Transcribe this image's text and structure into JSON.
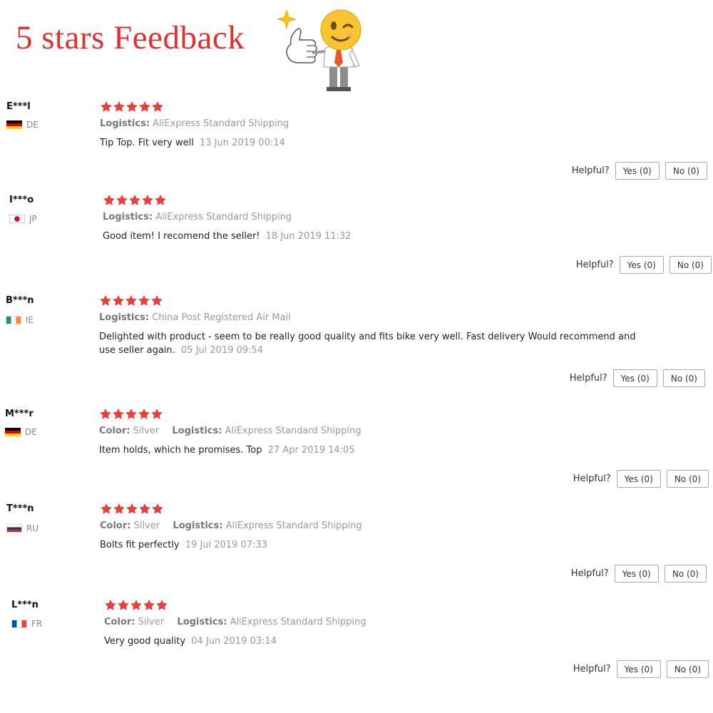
{
  "header": {
    "title": "5 stars Feedback"
  },
  "helpful_label": "Helpful?",
  "star_color": "#e8413c",
  "reviews": [
    {
      "user": "E***l",
      "country": "DE",
      "flag": "germany-flag-icon",
      "rating": 5,
      "color_label": "",
      "color_value": "",
      "logistics_label": "Logistics:",
      "logistics_value": "AliExpress Standard Shipping",
      "text": "Tip Top. Fit very well",
      "date": "13 Jun 2019 00:14",
      "yes": "Yes (0)",
      "no": "No (0)"
    },
    {
      "user": "I***o",
      "country": "JP",
      "flag": "japan-flag-icon",
      "rating": 5,
      "color_label": "",
      "color_value": "",
      "logistics_label": "Logistics:",
      "logistics_value": "AliExpress Standard Shipping",
      "text": "Good item! I recomend the seller!",
      "date": "18 Jun 2019 11:32",
      "yes": "Yes (0)",
      "no": "No (0)"
    },
    {
      "user": "B***n",
      "country": "IE",
      "flag": "ireland-flag-icon",
      "rating": 5,
      "color_label": "",
      "color_value": "",
      "logistics_label": "Logistics:",
      "logistics_value": "China Post Registered Air Mail",
      "text": "Delighted with product - seem to be really good quality and fits bike very well. Fast delivery Would recommend and use seller again.",
      "date": "05 Jul 2019 09:54",
      "yes": "Yes (0)",
      "no": "No (0)"
    },
    {
      "user": "M***r",
      "country": "DE",
      "flag": "germany-flag-icon",
      "rating": 5,
      "color_label": "Color:",
      "color_value": "Silver",
      "logistics_label": "Logistics:",
      "logistics_value": "AliExpress Standard Shipping",
      "text": "Item holds, which he promises. Top",
      "date": "27 Apr 2019 14:05",
      "yes": "Yes (0)",
      "no": "No (0)"
    },
    {
      "user": "T***n",
      "country": "RU",
      "flag": "russia-flag-icon",
      "rating": 5,
      "color_label": "Color:",
      "color_value": "Silver",
      "logistics_label": "Logistics:",
      "logistics_value": "AliExpress Standard Shipping",
      "text": "Bolts fit perfectly",
      "date": "19 Jul 2019 07:33",
      "yes": "Yes (0)",
      "no": "No (0)"
    },
    {
      "user": "L***n",
      "country": "FR",
      "flag": "france-flag-icon",
      "rating": 5,
      "color_label": "Color:",
      "color_value": "Silver",
      "logistics_label": "Logistics:",
      "logistics_value": "AliExpress Standard Shipping",
      "text": "Very good quality",
      "date": "04 Jun 2019 03:14",
      "yes": "Yes (0)",
      "no": "No (0)"
    }
  ]
}
